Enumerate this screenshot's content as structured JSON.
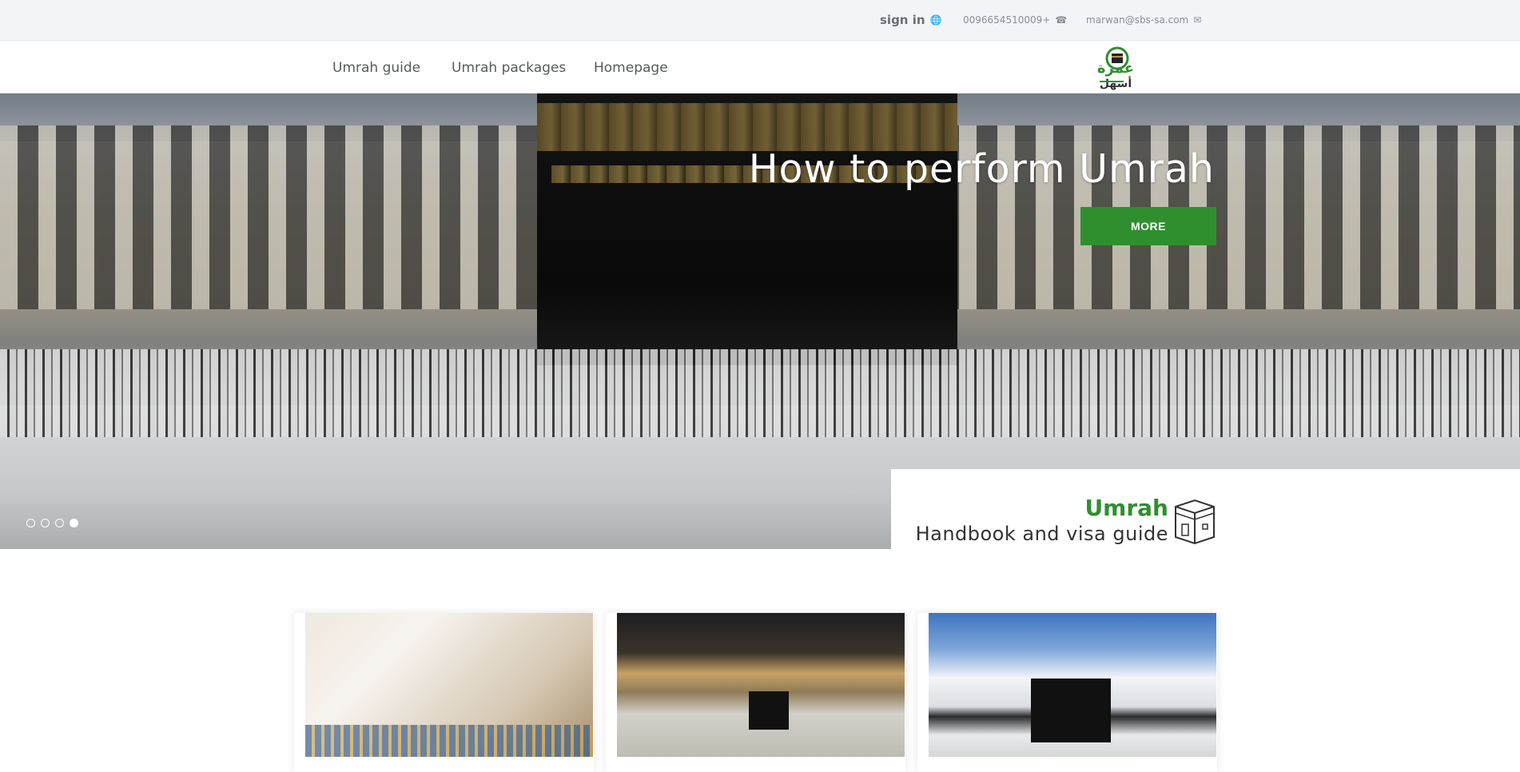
{
  "topbar": {
    "signin_label": "sign in",
    "signin_icon": "globe-icon",
    "phone": "0096654510009+",
    "phone_icon": "phone-icon",
    "email": "marwan@sbs-sa.com",
    "email_icon": "envelope-icon"
  },
  "nav": {
    "items": [
      {
        "label": "Umrah guide"
      },
      {
        "label": "Umrah packages"
      },
      {
        "label": "Homepage"
      }
    ],
    "logo_text_top": "عمرة",
    "logo_text_bottom": "أسهل"
  },
  "hero": {
    "title": "How to perform Umrah",
    "button_label": "MORE",
    "slides_count": 4,
    "active_slide": 4,
    "info_title": "Umrah",
    "info_subtitle": "Handbook and visa guide"
  },
  "cards": [
    {
      "image": "quran-stand-image"
    },
    {
      "image": "haram-night-image"
    },
    {
      "image": "kaaba-day-image"
    }
  ],
  "colors": {
    "accent": "#2f8f2f",
    "topbar_bg": "#f3f4f8",
    "text": "#555a60"
  }
}
